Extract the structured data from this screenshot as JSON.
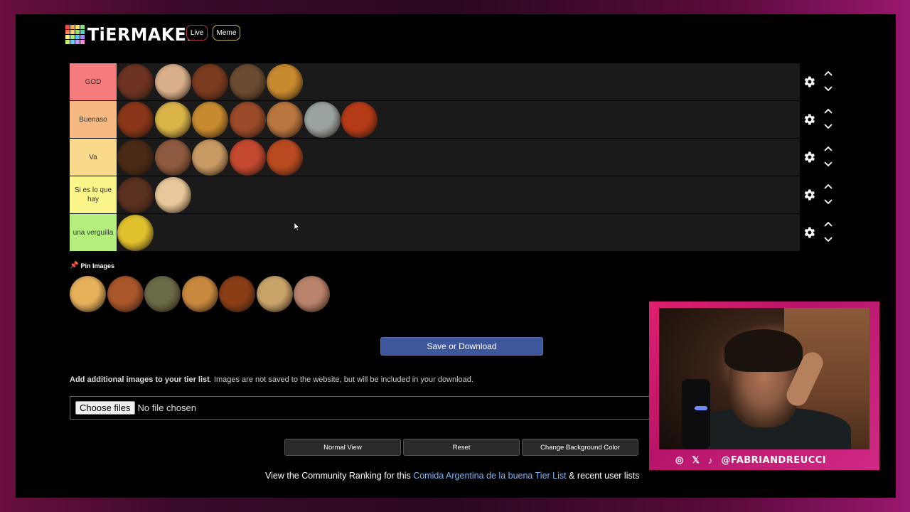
{
  "header": {
    "logo_text": "TiERMAKER",
    "live_label": "Live",
    "meme_label": "Meme",
    "logo_colors": [
      "#ff4a4a",
      "#ffb347",
      "#ffe066",
      "#7ae582",
      "#ff7f50",
      "#ffd166",
      "#9be564",
      "#4ecdc4",
      "#ffef85",
      "#a7f070",
      "#5ac8fa",
      "#b388ff",
      "#c5f277",
      "#64d2ff",
      "#c49cff",
      "#ff8ad8"
    ]
  },
  "tiers": [
    {
      "label": "GOD",
      "color": "#f47c7c",
      "items": [
        "#6e3323",
        "#d9b08c",
        "#7a3a1e",
        "#6b4b32",
        "#c8892f"
      ]
    },
    {
      "label": "Buenaso",
      "color": "#f7b982",
      "items": [
        "#8a3518",
        "#d8b448",
        "#c78a2e",
        "#9a4a28",
        "#b9763f",
        "#9aa3a0",
        "#b53a16"
      ]
    },
    {
      "label": "Va",
      "color": "#f9d98c",
      "items": [
        "#4a2a16",
        "#8e5a3f",
        "#c89a63",
        "#c4472f",
        "#b84a1f"
      ]
    },
    {
      "label": "Si es lo que hay",
      "color": "#fbf58a",
      "items": [
        "#5a3020",
        "#e8c89a"
      ]
    },
    {
      "label": "una verguilla",
      "color": "#b4f07c",
      "items": [
        "#e0c22e"
      ]
    }
  ],
  "pin": {
    "label": "Pin Images"
  },
  "pool_items": [
    "#e6b15b",
    "#a9562a",
    "#6b6a48",
    "#c8893e",
    "#8a3e16",
    "#c9a46a",
    "#b9826a"
  ],
  "save_label": "Save or Download",
  "add_images": {
    "bold": "Add additional images to your tier list",
    "rest": ". Images are not saved to the website, but will be included in your download."
  },
  "file_input": {
    "button": "Choose files",
    "status": "No file chosen"
  },
  "buttons": {
    "normal_view": "Normal View",
    "reset": "Reset",
    "change_bg": "Change Background Color"
  },
  "community": {
    "prefix": "View the Community Ranking for this ",
    "link": "Comida Argentina de la buena Tier List",
    "suffix": " & recent user lists"
  },
  "webcam": {
    "handle": "@FABRIANDREUCCI"
  }
}
